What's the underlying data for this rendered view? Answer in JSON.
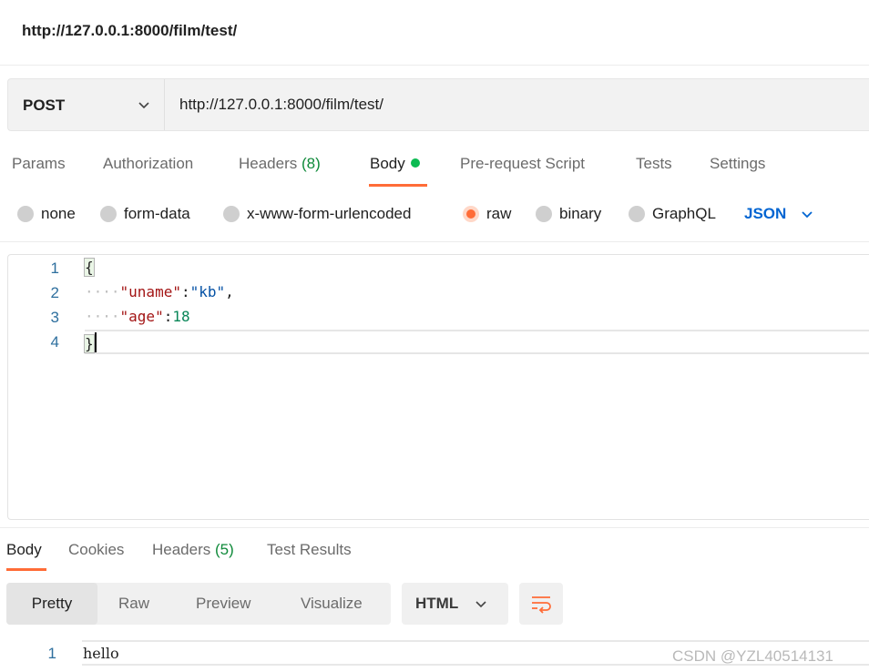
{
  "window": {
    "title": "http://127.0.0.1:8000/film/test/"
  },
  "request": {
    "method": "POST",
    "url": "http://127.0.0.1:8000/film/test/"
  },
  "request_tabs": [
    {
      "label": "Params"
    },
    {
      "label": "Authorization"
    },
    {
      "label": "Headers",
      "count": "(8)"
    },
    {
      "label": "Body",
      "active": true
    },
    {
      "label": "Pre-request Script"
    },
    {
      "label": "Tests"
    },
    {
      "label": "Settings"
    }
  ],
  "body_types": [
    {
      "label": "none"
    },
    {
      "label": "form-data"
    },
    {
      "label": "x-www-form-urlencoded"
    },
    {
      "label": "raw",
      "checked": true
    },
    {
      "label": "binary"
    },
    {
      "label": "GraphQL"
    }
  ],
  "body_language": "JSON",
  "editor": {
    "line_numbers": [
      "1",
      "2",
      "3",
      "4"
    ],
    "brace_open": "{",
    "brace_close": "}",
    "indent_dots": "····",
    "key1": "\"uname\"",
    "val1": "\"kb\"",
    "key2": "\"age\"",
    "val2": "18",
    "colon": ":",
    "comma": ","
  },
  "response_tabs": [
    {
      "label": "Body",
      "active": true
    },
    {
      "label": "Cookies"
    },
    {
      "label": "Headers",
      "count": "(5)"
    },
    {
      "label": "Test Results"
    }
  ],
  "view_modes": [
    {
      "label": "Pretty",
      "active": true
    },
    {
      "label": "Raw"
    },
    {
      "label": "Preview"
    },
    {
      "label": "Visualize"
    }
  ],
  "response_language": "HTML",
  "response": {
    "line_number": "1",
    "text": "hello"
  },
  "watermark": "CSDN @YZL40514131",
  "colors": {
    "accent": "#ff6c37",
    "active_dot": "#0cbb52",
    "link_blue": "#0265d2"
  },
  "icons": {
    "method_dropdown": "chevron-down-icon",
    "language_dropdown": "chevron-down-icon",
    "wrap": "wrap-lines-icon"
  }
}
